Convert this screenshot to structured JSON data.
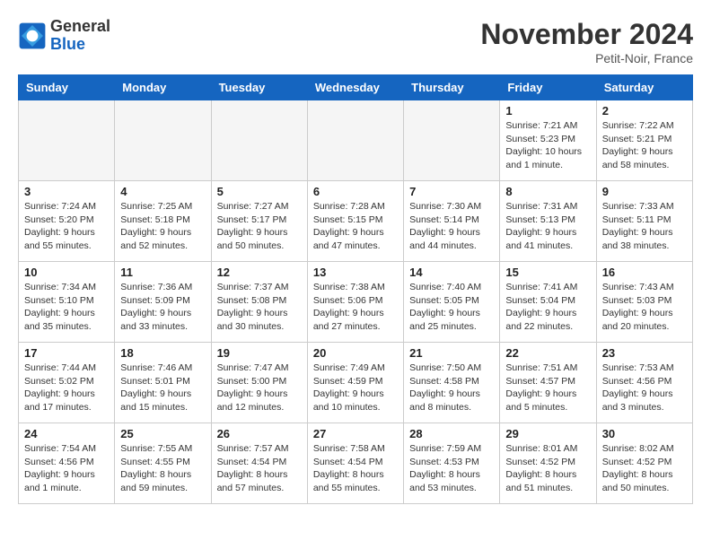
{
  "logo": {
    "text_general": "General",
    "text_blue": "Blue"
  },
  "header": {
    "month": "November 2024",
    "location": "Petit-Noir, France"
  },
  "weekdays": [
    "Sunday",
    "Monday",
    "Tuesday",
    "Wednesday",
    "Thursday",
    "Friday",
    "Saturday"
  ],
  "weeks": [
    [
      {
        "day": "",
        "empty": true
      },
      {
        "day": "",
        "empty": true
      },
      {
        "day": "",
        "empty": true
      },
      {
        "day": "",
        "empty": true
      },
      {
        "day": "",
        "empty": true
      },
      {
        "day": "1",
        "sunrise": "Sunrise: 7:21 AM",
        "sunset": "Sunset: 5:23 PM",
        "daylight": "Daylight: 10 hours and 1 minute."
      },
      {
        "day": "2",
        "sunrise": "Sunrise: 7:22 AM",
        "sunset": "Sunset: 5:21 PM",
        "daylight": "Daylight: 9 hours and 58 minutes."
      }
    ],
    [
      {
        "day": "3",
        "sunrise": "Sunrise: 7:24 AM",
        "sunset": "Sunset: 5:20 PM",
        "daylight": "Daylight: 9 hours and 55 minutes."
      },
      {
        "day": "4",
        "sunrise": "Sunrise: 7:25 AM",
        "sunset": "Sunset: 5:18 PM",
        "daylight": "Daylight: 9 hours and 52 minutes."
      },
      {
        "day": "5",
        "sunrise": "Sunrise: 7:27 AM",
        "sunset": "Sunset: 5:17 PM",
        "daylight": "Daylight: 9 hours and 50 minutes."
      },
      {
        "day": "6",
        "sunrise": "Sunrise: 7:28 AM",
        "sunset": "Sunset: 5:15 PM",
        "daylight": "Daylight: 9 hours and 47 minutes."
      },
      {
        "day": "7",
        "sunrise": "Sunrise: 7:30 AM",
        "sunset": "Sunset: 5:14 PM",
        "daylight": "Daylight: 9 hours and 44 minutes."
      },
      {
        "day": "8",
        "sunrise": "Sunrise: 7:31 AM",
        "sunset": "Sunset: 5:13 PM",
        "daylight": "Daylight: 9 hours and 41 minutes."
      },
      {
        "day": "9",
        "sunrise": "Sunrise: 7:33 AM",
        "sunset": "Sunset: 5:11 PM",
        "daylight": "Daylight: 9 hours and 38 minutes."
      }
    ],
    [
      {
        "day": "10",
        "sunrise": "Sunrise: 7:34 AM",
        "sunset": "Sunset: 5:10 PM",
        "daylight": "Daylight: 9 hours and 35 minutes."
      },
      {
        "day": "11",
        "sunrise": "Sunrise: 7:36 AM",
        "sunset": "Sunset: 5:09 PM",
        "daylight": "Daylight: 9 hours and 33 minutes."
      },
      {
        "day": "12",
        "sunrise": "Sunrise: 7:37 AM",
        "sunset": "Sunset: 5:08 PM",
        "daylight": "Daylight: 9 hours and 30 minutes."
      },
      {
        "day": "13",
        "sunrise": "Sunrise: 7:38 AM",
        "sunset": "Sunset: 5:06 PM",
        "daylight": "Daylight: 9 hours and 27 minutes."
      },
      {
        "day": "14",
        "sunrise": "Sunrise: 7:40 AM",
        "sunset": "Sunset: 5:05 PM",
        "daylight": "Daylight: 9 hours and 25 minutes."
      },
      {
        "day": "15",
        "sunrise": "Sunrise: 7:41 AM",
        "sunset": "Sunset: 5:04 PM",
        "daylight": "Daylight: 9 hours and 22 minutes."
      },
      {
        "day": "16",
        "sunrise": "Sunrise: 7:43 AM",
        "sunset": "Sunset: 5:03 PM",
        "daylight": "Daylight: 9 hours and 20 minutes."
      }
    ],
    [
      {
        "day": "17",
        "sunrise": "Sunrise: 7:44 AM",
        "sunset": "Sunset: 5:02 PM",
        "daylight": "Daylight: 9 hours and 17 minutes."
      },
      {
        "day": "18",
        "sunrise": "Sunrise: 7:46 AM",
        "sunset": "Sunset: 5:01 PM",
        "daylight": "Daylight: 9 hours and 15 minutes."
      },
      {
        "day": "19",
        "sunrise": "Sunrise: 7:47 AM",
        "sunset": "Sunset: 5:00 PM",
        "daylight": "Daylight: 9 hours and 12 minutes."
      },
      {
        "day": "20",
        "sunrise": "Sunrise: 7:49 AM",
        "sunset": "Sunset: 4:59 PM",
        "daylight": "Daylight: 9 hours and 10 minutes."
      },
      {
        "day": "21",
        "sunrise": "Sunrise: 7:50 AM",
        "sunset": "Sunset: 4:58 PM",
        "daylight": "Daylight: 9 hours and 8 minutes."
      },
      {
        "day": "22",
        "sunrise": "Sunrise: 7:51 AM",
        "sunset": "Sunset: 4:57 PM",
        "daylight": "Daylight: 9 hours and 5 minutes."
      },
      {
        "day": "23",
        "sunrise": "Sunrise: 7:53 AM",
        "sunset": "Sunset: 4:56 PM",
        "daylight": "Daylight: 9 hours and 3 minutes."
      }
    ],
    [
      {
        "day": "24",
        "sunrise": "Sunrise: 7:54 AM",
        "sunset": "Sunset: 4:56 PM",
        "daylight": "Daylight: 9 hours and 1 minute."
      },
      {
        "day": "25",
        "sunrise": "Sunrise: 7:55 AM",
        "sunset": "Sunset: 4:55 PM",
        "daylight": "Daylight: 8 hours and 59 minutes."
      },
      {
        "day": "26",
        "sunrise": "Sunrise: 7:57 AM",
        "sunset": "Sunset: 4:54 PM",
        "daylight": "Daylight: 8 hours and 57 minutes."
      },
      {
        "day": "27",
        "sunrise": "Sunrise: 7:58 AM",
        "sunset": "Sunset: 4:54 PM",
        "daylight": "Daylight: 8 hours and 55 minutes."
      },
      {
        "day": "28",
        "sunrise": "Sunrise: 7:59 AM",
        "sunset": "Sunset: 4:53 PM",
        "daylight": "Daylight: 8 hours and 53 minutes."
      },
      {
        "day": "29",
        "sunrise": "Sunrise: 8:01 AM",
        "sunset": "Sunset: 4:52 PM",
        "daylight": "Daylight: 8 hours and 51 minutes."
      },
      {
        "day": "30",
        "sunrise": "Sunrise: 8:02 AM",
        "sunset": "Sunset: 4:52 PM",
        "daylight": "Daylight: 8 hours and 50 minutes."
      }
    ]
  ]
}
